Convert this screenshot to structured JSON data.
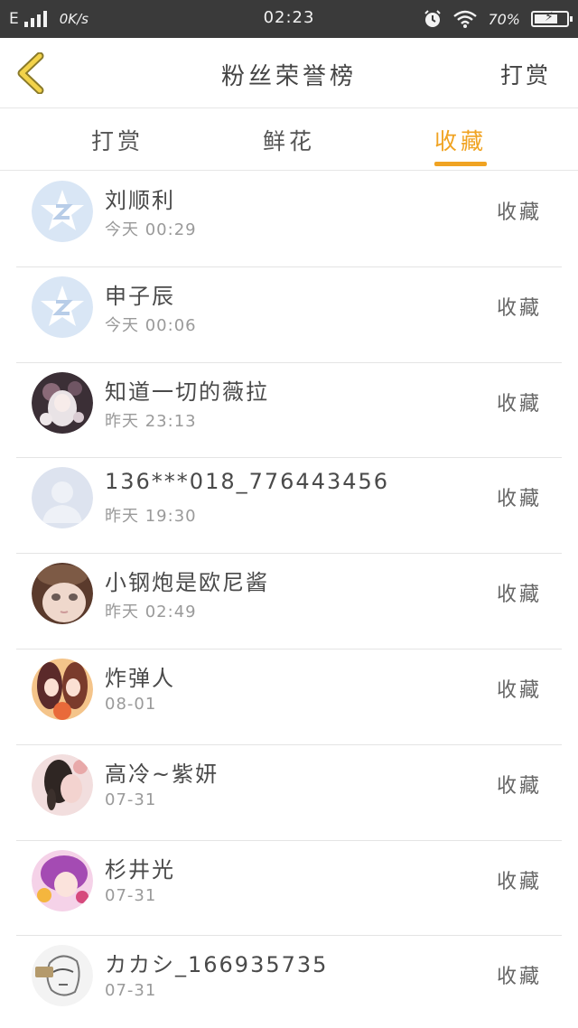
{
  "status_bar": {
    "network": "E",
    "speed": "0K/s",
    "time": "02:23",
    "battery": "70%",
    "icons": [
      "signal-icon",
      "alarm-icon",
      "wifi-icon",
      "battery-icon"
    ]
  },
  "header": {
    "title": "粉丝荣誉榜",
    "action": "打赏",
    "back_icon": "chevron-left-icon"
  },
  "tabs": [
    {
      "label": "打赏",
      "active": false
    },
    {
      "label": "鲜花",
      "active": false
    },
    {
      "label": "收藏",
      "active": true
    }
  ],
  "colors": {
    "accent": "#f0a322",
    "status_bar_bg": "#3a3a3a",
    "divider": "#e4e4e4"
  },
  "fans": [
    {
      "name": "刘顺利",
      "time": "今天 00:29",
      "action": "收藏",
      "avatar": "default-qq-star-avatar"
    },
    {
      "name": "申子辰",
      "time": "今天 00:06",
      "action": "收藏",
      "avatar": "default-qq-star-avatar"
    },
    {
      "name": "知道一切的薇拉",
      "time": "昨天 23:13",
      "action": "收藏",
      "avatar": "anime-girl-avatar"
    },
    {
      "name": "136***018_776443456",
      "time": "昨天 19:30",
      "action": "收藏",
      "avatar": "default-person-avatar"
    },
    {
      "name": "小钢炮是欧尼酱",
      "time": "昨天 02:49",
      "action": "收藏",
      "avatar": "doll-face-avatar"
    },
    {
      "name": "炸弹人",
      "time": "08-01",
      "action": "收藏",
      "avatar": "anime-twins-avatar"
    },
    {
      "name": "高冷~紫妍",
      "time": "07-31",
      "action": "收藏",
      "avatar": "braided-girl-avatar"
    },
    {
      "name": "杉井光",
      "time": "07-31",
      "action": "收藏",
      "avatar": "purple-hair-anime-avatar"
    },
    {
      "name": "カカシ_166935735",
      "time": "07-31",
      "action": "收藏",
      "avatar": "sketch-character-avatar"
    }
  ]
}
